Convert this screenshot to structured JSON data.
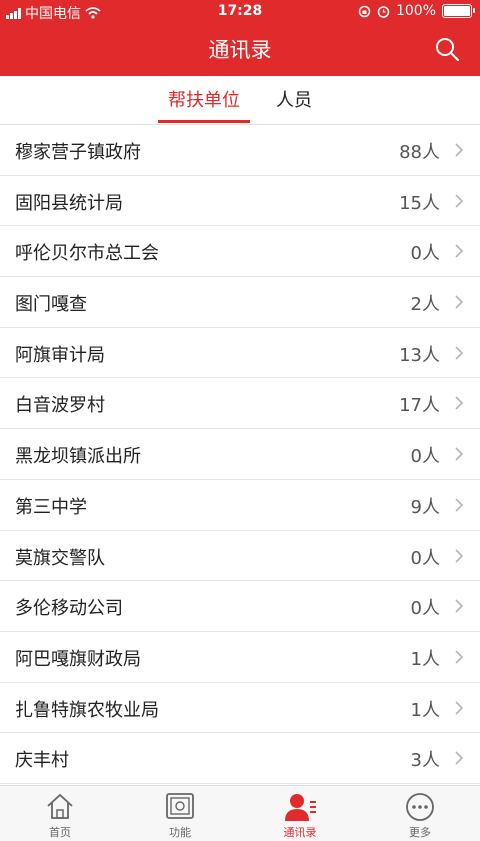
{
  "status_bar": {
    "carrier": "中国电信",
    "time": "17:28",
    "battery": "100%"
  },
  "header": {
    "title": "通讯录",
    "search_icon": "search-icon"
  },
  "tabs": [
    {
      "label": "帮扶单位",
      "active": true
    },
    {
      "label": "人员",
      "active": false
    }
  ],
  "units": [
    {
      "name": "穆家营子镇政府",
      "count": "88人"
    },
    {
      "name": "固阳县统计局",
      "count": "15人"
    },
    {
      "name": "呼伦贝尔市总工会",
      "count": "0人"
    },
    {
      "name": "图门嘎查",
      "count": "2人"
    },
    {
      "name": "阿旗审计局",
      "count": "13人"
    },
    {
      "name": "白音波罗村",
      "count": "17人"
    },
    {
      "name": "黑龙坝镇派出所",
      "count": "0人"
    },
    {
      "name": "第三中学",
      "count": "9人"
    },
    {
      "name": "莫旗交警队",
      "count": "0人"
    },
    {
      "name": "多伦移动公司",
      "count": "0人"
    },
    {
      "name": "阿巴嘎旗财政局",
      "count": "1人"
    },
    {
      "name": "扎鲁特旗农牧业局",
      "count": "1人"
    },
    {
      "name": "庆丰村",
      "count": "3人"
    }
  ],
  "bottom_nav": [
    {
      "label": "首页",
      "icon": "home-icon",
      "active": false
    },
    {
      "label": "功能",
      "icon": "function-icon",
      "active": false
    },
    {
      "label": "通讯录",
      "icon": "contacts-icon",
      "active": true
    },
    {
      "label": "更多",
      "icon": "more-icon",
      "active": false
    }
  ],
  "colors": {
    "brand": "#e02a2b"
  }
}
